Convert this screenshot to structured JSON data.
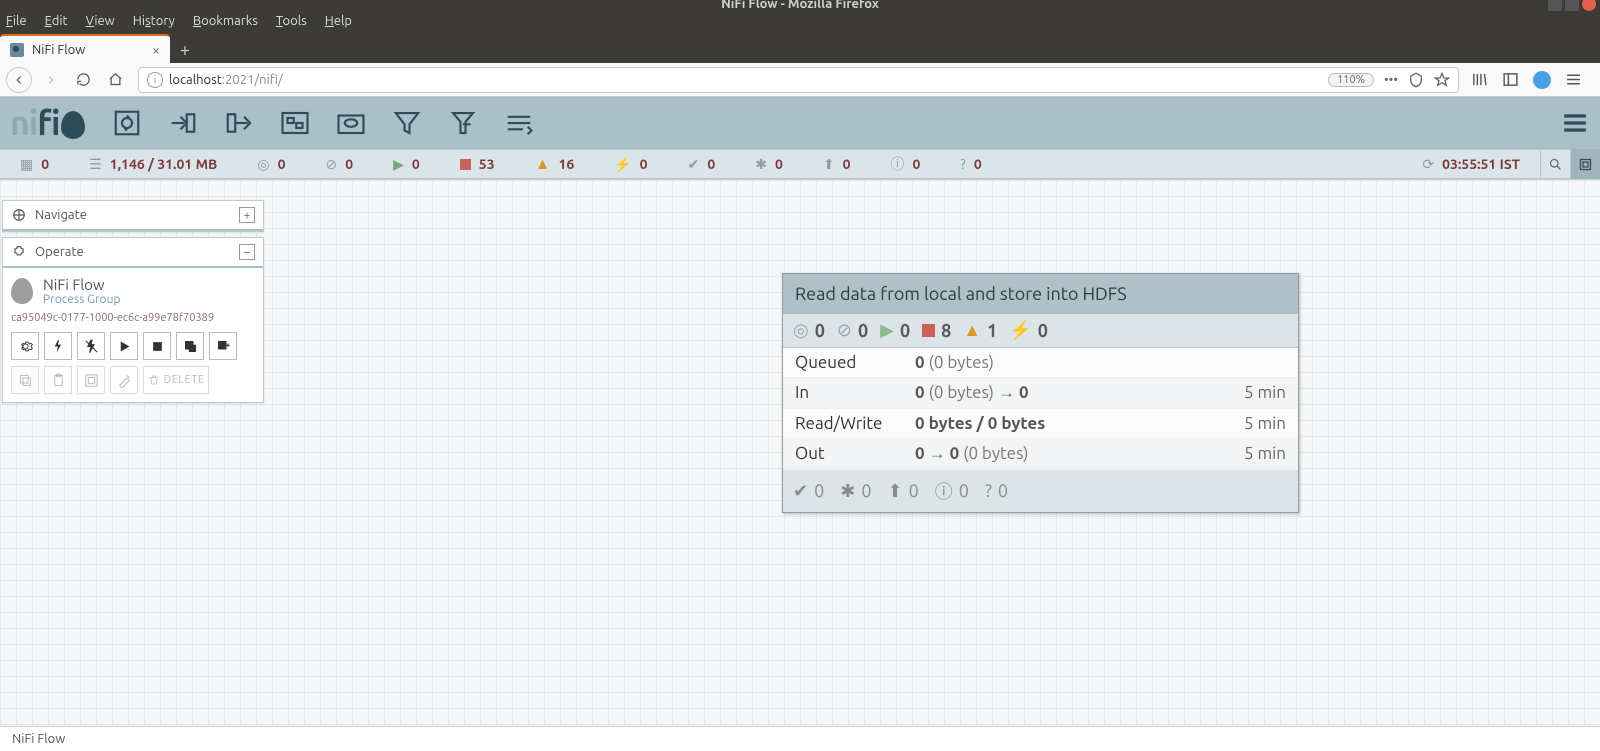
{
  "window": {
    "title": "NiFi Flow - Mozilla Firefox"
  },
  "menubar": {
    "file": "File",
    "edit": "Edit",
    "view": "View",
    "history": "History",
    "bookmarks": "Bookmarks",
    "tools": "Tools",
    "help": "Help"
  },
  "tab": {
    "label": "NiFi Flow"
  },
  "url": {
    "host_dim": "localhost",
    "port": ":2021",
    "path": "/nifi/",
    "zoom": "110%"
  },
  "flow_status": {
    "active_threads": "0",
    "queued": "1,146 / 31.01 MB",
    "transmitting": "0",
    "not_transmitting": "0",
    "running": "0",
    "stopped": "53",
    "invalid": "16",
    "disabled": "0",
    "up_to_date": "0",
    "locally_modified": "0",
    "stale": "0",
    "sync_failure": "0",
    "unknown": "0",
    "refresh": "03:55:51 IST"
  },
  "navigate": {
    "title": "Navigate"
  },
  "operate": {
    "title": "Operate",
    "name": "NiFi Flow",
    "type": "Process Group",
    "id": "ca95049c-0177-1000-ec6c-a99e78f70389",
    "delete": "DELETE"
  },
  "pg": {
    "title": "Read data from local and store into HDFS",
    "stats": {
      "transmitting": "0",
      "not_transmitting": "0",
      "running": "0",
      "stopped": "8",
      "invalid": "1",
      "disabled": "0"
    },
    "rows": {
      "queued_label": "Queued",
      "queued_val": "0",
      "queued_bytes": "(0 bytes)",
      "in_label": "In",
      "in_val": "0",
      "in_bytes": "(0 bytes)",
      "in_arrow": "→",
      "in_out": "0",
      "in_time": "5 min",
      "rw_label": "Read/Write",
      "rw_val": "0 bytes / 0 bytes",
      "rw_time": "5 min",
      "out_label": "Out",
      "out_val1": "0",
      "out_arrow": "→",
      "out_val2": "0",
      "out_bytes": "(0 bytes)",
      "out_time": "5 min"
    },
    "foot": {
      "c1": "0",
      "c2": "0",
      "c3": "0",
      "c4": "0",
      "c5": "0"
    }
  },
  "footer": {
    "breadcrumb": "NiFi Flow"
  }
}
